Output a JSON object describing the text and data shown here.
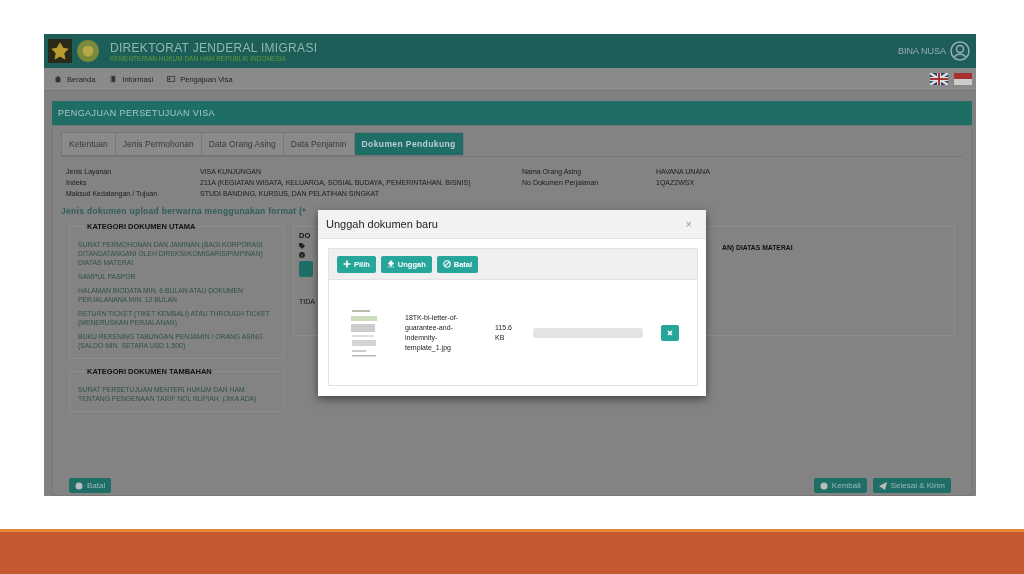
{
  "header": {
    "title": "DIREKTORAT JENDERAL IMIGRASI",
    "subtitle": "KEMENTERIAN HUKUM DAN HAM REPUBLIK INDONESIA",
    "user": "BINA NUSA"
  },
  "nav": [
    {
      "label": "Beranda",
      "kind": "home"
    },
    {
      "label": "Informasi",
      "kind": "book"
    },
    {
      "label": "Pengajuan Visa",
      "kind": "card"
    }
  ],
  "panel_title": "PENGAJUAN PERSETUJUAN VISA",
  "tabs": [
    {
      "label": "Ketentuan",
      "selected": false
    },
    {
      "label": "Jenis Permohonan",
      "selected": false
    },
    {
      "label": "Data Orang Asing",
      "selected": false
    },
    {
      "label": "Data Penjamin",
      "selected": false
    },
    {
      "label": "Dokumen Pendukung",
      "selected": true
    }
  ],
  "info_left": [
    {
      "label": "Jenis Layanan",
      "value": "VISA KUNJUNGAN"
    },
    {
      "label": "Indeks",
      "value": "211A  (KEGIATAN WISATA, KELUARGA, SOSIAL BUDAYA, PEMERINTAHAN, BISNIS)"
    },
    {
      "label": "Maksud Kedatangan / Tujuan",
      "value": "STUDI BANDING, KURSUS, DAN PELATIHAN SINGKAT"
    }
  ],
  "info_right": [
    {
      "label": "Nama Orang Asing",
      "value": "HAVANA UNANA"
    },
    {
      "label": "No Dokumen Perjalanan",
      "value": "1QAZ2WSX"
    }
  ],
  "note": "Jenis dokumen upload berwarna menggunakan format (*",
  "categories": [
    {
      "title": "KATEGORI DOKUMEN UTAMA",
      "items": [
        "SURAT PERMOHONAN DAN JAMINAN (BAGI KORPORASI DITANDATANGANI OLEH DIREKSI/KOMISARIS/PIMPINAN) DIATAS MATERAI",
        "SAMPUL PASPOR",
        "HALAMAN BIODATA MIN. 6 BULAN ATAU DOKUMEN PERJALANANA MIN. 12 BULAN",
        "RETURN TICKET (TIKET KEMBALI) ATAU THROUGH TICKET (MENERUSKAN PERJALANAN)",
        "BUKU REKENING TABUNGAN PENJAMIN / ORANG ASING (SALDO MIN. SETARA USD 1.500)"
      ]
    },
    {
      "title": "KATEGORI DOKUMEN TAMBAHAN",
      "items": [
        "SURAT PERSETUJUAN MENTERI HUKUM DAN HAM TENTANG PENGENAAN TARIF NOL RUPIAH. (JIKA ADA)"
      ]
    }
  ],
  "doc_panel": {
    "heading": "DO",
    "title_tail": "AN) DIATAS MATERAI",
    "status": "TIDA"
  },
  "modal": {
    "title": "Unggah dokumen baru",
    "close": "×",
    "buttons": [
      {
        "label": "Pilih",
        "kind": "add"
      },
      {
        "label": "Unggah",
        "kind": "upload"
      },
      {
        "label": "Batal",
        "kind": "cancel"
      }
    ],
    "file": {
      "name": "18TK-bi-letter-of-guarantee-and-indemnity-template_1.jpg",
      "size": "115.6 KB",
      "level": 0
    }
  },
  "footer_buttons": [
    {
      "label": "Batal",
      "kind": "cancel"
    },
    {
      "label": "Kembali",
      "kind": "back"
    },
    {
      "label": "Selesai & Kirim",
      "kind": "send"
    }
  ]
}
